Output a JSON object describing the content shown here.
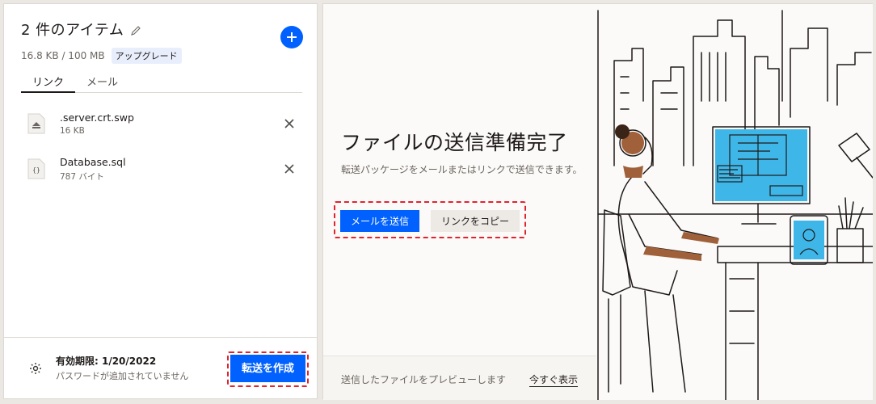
{
  "left": {
    "title": "2 件のアイテム",
    "usage": "16.8 KB / 100 MB",
    "upgrade_label": "アップグレード",
    "tabs": [
      {
        "label": "リンク",
        "active": true
      },
      {
        "label": "メール",
        "active": false
      }
    ],
    "files": [
      {
        "name": ".server.crt.swp",
        "size": "16 KB",
        "icon": "generic-file-icon"
      },
      {
        "name": "Database.sql",
        "size": "787 バイト",
        "icon": "code-file-icon"
      }
    ],
    "footer": {
      "expiry": "有効期限: 1/20/2022",
      "password_status": "パスワードが追加されていません",
      "create_button": "転送を作成"
    }
  },
  "right": {
    "title": "ファイルの送信準備完了",
    "description": "転送パッケージをメールまたはリンクで送信できます。",
    "send_email_button": "メールを送信",
    "copy_link_button": "リンクをコピー",
    "preview_text": "送信したファイルをプレビューします",
    "preview_link": "今すぐ表示"
  },
  "colors": {
    "accent": "#0061fe",
    "highlight": "#e0242f",
    "screen": "#3fb6e8",
    "skin": "#a0603a"
  }
}
